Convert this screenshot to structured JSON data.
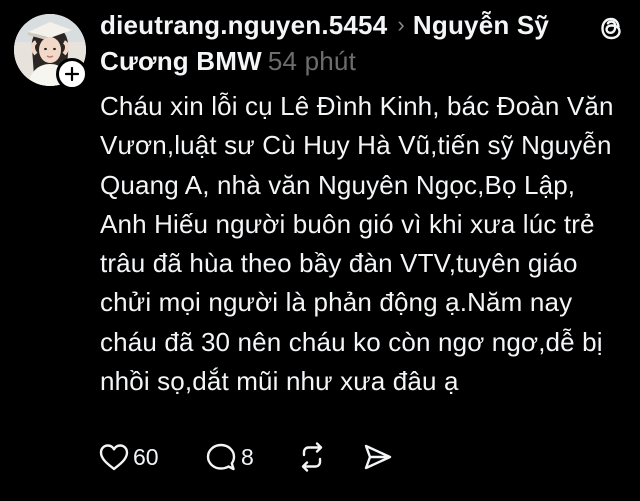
{
  "post": {
    "username": "dieutrang.nguyen.5454",
    "reply_separator_icon": "chevron-right-icon",
    "reply_to": "Nguyễn Sỹ Cương BMW",
    "time_ago": "54 phút",
    "text": "Cháu xin lỗi cụ Lê Đình Kinh, bác Đoàn Văn Vươn,luật sư Cù Huy Hà Vũ,tiến sỹ Nguyễn Quang A, nhà văn Nguyên Ngọc,Bọ Lập, Anh Hiếu người buôn gió vì khi xưa lúc trẻ trâu đã hùa theo bầy đàn VTV,tuyên giáo chửi mọi người là phản động ạ.Năm nay cháu đã 30 nên cháu ko còn ngơ ngơ,dễ bị nhồi sọ,dắt mũi như xưa đâu ạ"
  },
  "actions": {
    "like_count": "60",
    "comment_count": "8",
    "like_icon": "heart-icon",
    "comment_icon": "speech-bubble-icon",
    "repost_icon": "repost-icon",
    "share_icon": "send-icon"
  },
  "app": {
    "logo_icon": "threads-logo-icon",
    "follow_icon": "plus-icon"
  },
  "colors": {
    "background": "#000000",
    "text": "#f3f5f7",
    "muted": "#6d6d6d"
  }
}
